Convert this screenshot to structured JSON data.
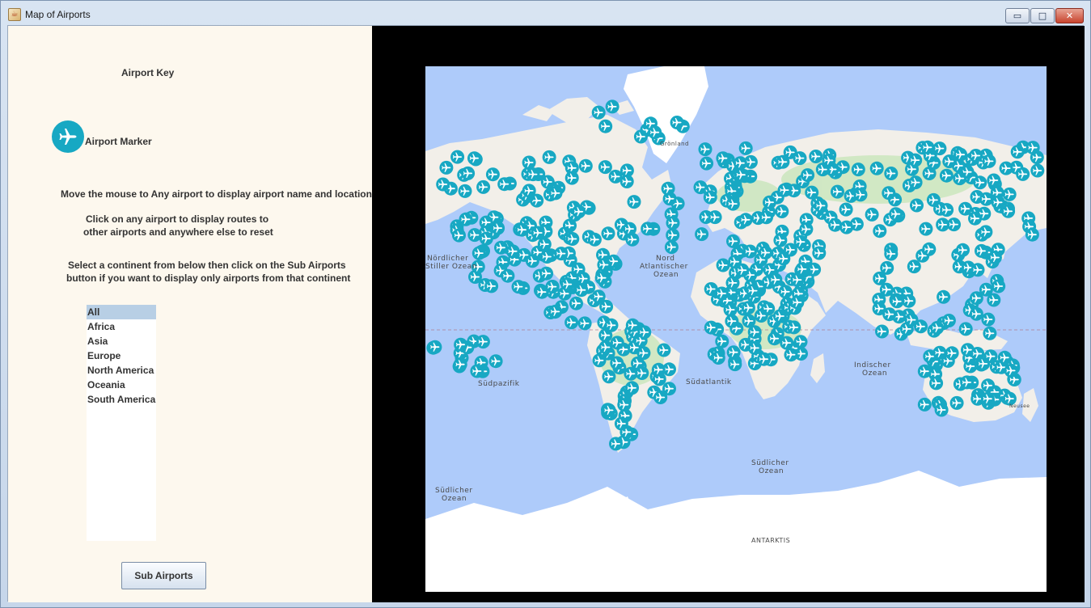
{
  "window": {
    "title": "Map of Airports",
    "buttons": {
      "minimize": "▭",
      "maximize": "□",
      "close": "✕"
    }
  },
  "key": {
    "title": "Airport Key",
    "marker_label": "Airport Marker",
    "marker_icon": "airplane-icon",
    "marker_color": "#17a8c3"
  },
  "instructions": {
    "hover": "Move the mouse to Any airport to display airport name and location",
    "click_line1": "Click on any airport to display routes to",
    "click_line2": "other airports and anywhere else to reset",
    "select_line1": "Select a continent from below then click on the Sub Airports",
    "select_line2": "button if you want to display only airports from that continent"
  },
  "continents": {
    "selected": "All",
    "items": [
      "All",
      "Africa",
      "Asia",
      "Europe",
      "North America",
      "Oceania",
      "South America"
    ]
  },
  "sub_airports_button": "Sub Airports",
  "map": {
    "colors": {
      "ocean": "#aecbfa",
      "land": "#f2efe9",
      "ice": "#ffffff",
      "green": "#cde7c0",
      "marker": "#17a8c3"
    },
    "labels": {
      "greenland": "Grönland",
      "north_pacific": [
        "Nördlicher",
        "Stiller Ozean"
      ],
      "north_atlantic": [
        "Nord",
        "Atlantischer",
        "Ozean"
      ],
      "south_pacific": "Südpazifik",
      "south_atlantic": "Südatlantik",
      "indian_ocean": [
        "Indischer",
        "Ozean"
      ],
      "southern_ocean_left": [
        "Südlicher",
        "Ozean"
      ],
      "southern_ocean_mid": [
        "Südlicher",
        "Ozean"
      ],
      "antarctica": "ANTARKTIS",
      "neusee": "Neusee"
    }
  }
}
